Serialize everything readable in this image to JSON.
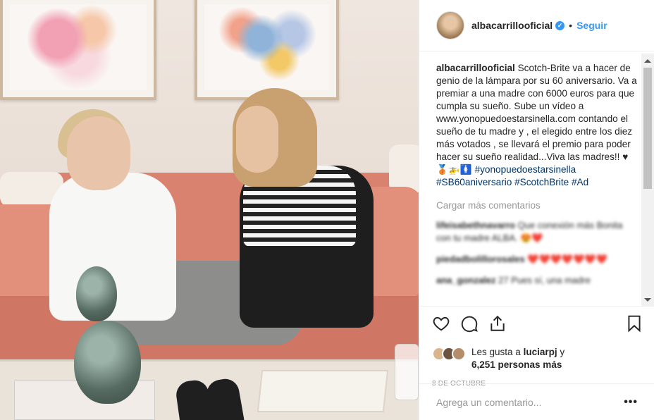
{
  "header": {
    "username": "albacarrillooficial",
    "dot": "•",
    "follow_label": "Seguir"
  },
  "caption": {
    "username": "albacarrillooficial",
    "text": "Scotch-Brite va a hacer de genio de la lámpara por su 60 aniversario. Va a premiar a una madre con 6000 euros para que cumpla su sueño. Sube un vídeo a www.yonopuedoestarsinella.com contando el sueño de tu madre y , el elegido entre los diez más votados , se llevará el premio para poder hacer su sueño realidad...Viva las madres!! ♥🥉🚁🚺",
    "hashtags": [
      "#yonopuedoestarsinella",
      "#SB60aniversario",
      "#ScotchBrite",
      "#Ad"
    ]
  },
  "load_more_label": "Cargar más comentarios",
  "comments": [
    {
      "username": "lifeisabethnavarro",
      "text": "Que conexión más Bonita con tu madre ALBA. 😍❤️"
    },
    {
      "username": "piedadbolillorosales",
      "text": "❤️❤️❤️❤️❤️❤️❤️"
    },
    {
      "username": "ana_gonzalez",
      "text": "27 Pues sí, una madre"
    }
  ],
  "likes": {
    "prefix": "Les gusta a",
    "user": "luciarpj",
    "joiner": "y",
    "count": "6,251 personas más"
  },
  "date": "8 DE OCTUBRE",
  "add_comment": {
    "placeholder": "Agrega un comentario...",
    "more_label": "•••"
  },
  "colors": {
    "accent": "#3897f0",
    "hashtag": "#003569",
    "muted": "#999999"
  },
  "icons": [
    "heart-icon",
    "comment-icon",
    "share-icon",
    "bookmark-icon",
    "verified-icon"
  ]
}
